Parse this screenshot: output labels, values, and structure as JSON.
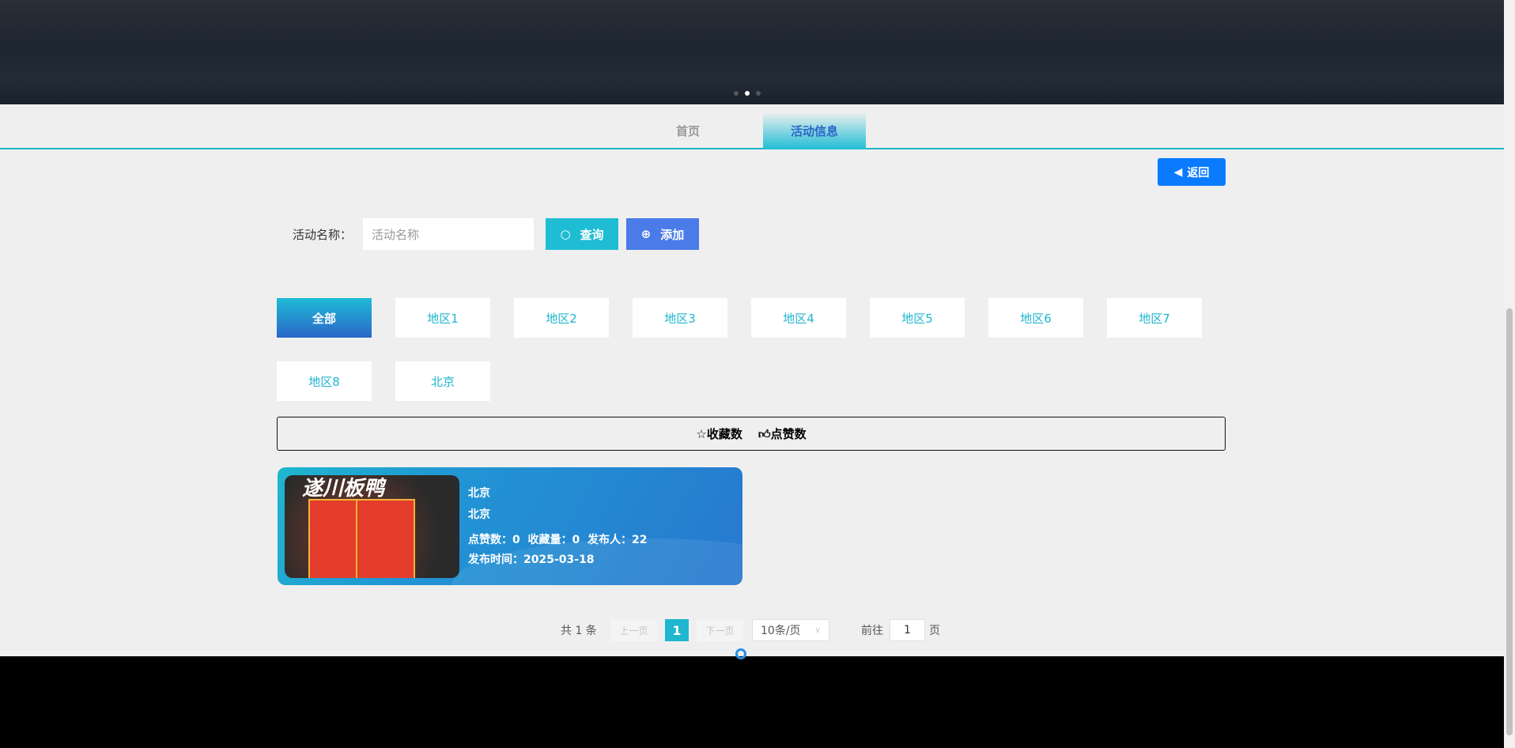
{
  "nav": {
    "tabs": [
      {
        "label": "首页"
      },
      {
        "label": "活动信息"
      }
    ]
  },
  "back_label": "返回",
  "search": {
    "label": "活动名称：",
    "placeholder": "活动名称",
    "query_label": "查询",
    "add_label": "添加"
  },
  "categories": [
    "全部",
    "地区1",
    "地区2",
    "地区3",
    "地区4",
    "地区5",
    "地区6",
    "地区7",
    "地区8",
    "北京"
  ],
  "sort": {
    "favorites": "收藏数",
    "likes": "点赞数"
  },
  "cards": [
    {
      "image_text": "遂川板鸭",
      "title": "北京",
      "region": "北京",
      "stats": "点赞数：0  收藏量：0  发布人：22",
      "time": "发布时间：2025-03-18"
    }
  ],
  "pagination": {
    "total": "共 1 条",
    "prev": "上一页",
    "current": "1",
    "next": "下一页",
    "page_size": "10条/页",
    "goto": "前往",
    "goto_value": "1",
    "page_suffix": "页"
  },
  "colors": {
    "accent": "#1fb6cf",
    "primary": "#0a7bff",
    "add": "#4a7be8"
  }
}
